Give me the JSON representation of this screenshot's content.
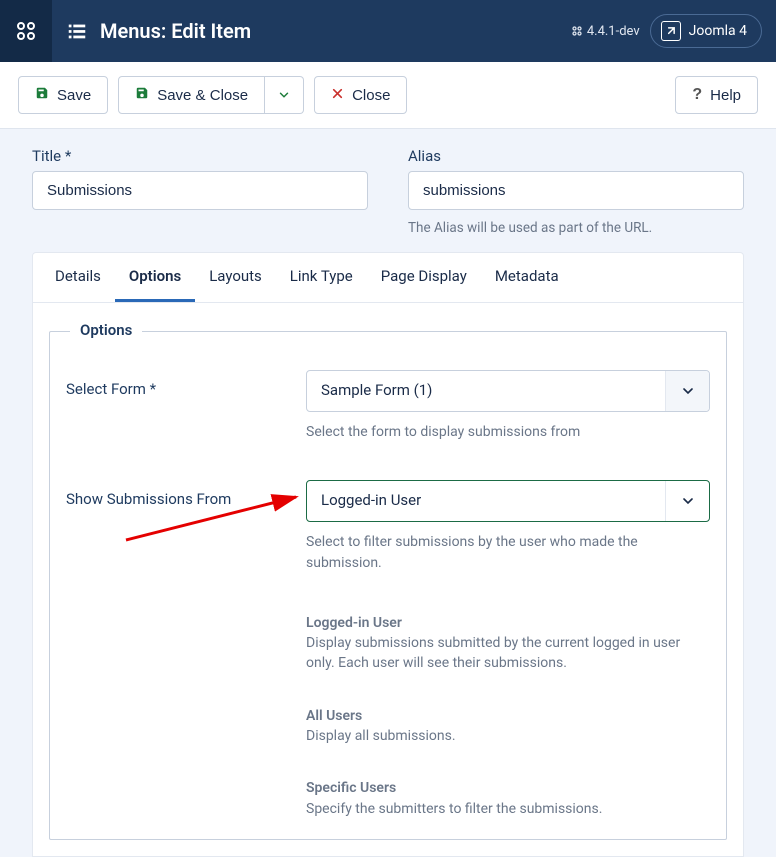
{
  "header": {
    "title": "Menus: Edit Item",
    "version": "4.4.1-dev",
    "badge": "Joomla 4"
  },
  "toolbar": {
    "save": "Save",
    "save_close": "Save & Close",
    "close": "Close",
    "help": "Help"
  },
  "fields": {
    "title_label": "Title *",
    "title_value": "Submissions",
    "alias_label": "Alias",
    "alias_value": "submissions",
    "alias_hint": "The Alias will be used as part of the URL."
  },
  "tabs": [
    "Details",
    "Options",
    "Layouts",
    "Link Type",
    "Page Display",
    "Metadata"
  ],
  "active_tab": "Options",
  "fieldset_legend": "Options",
  "controls": {
    "select_form": {
      "label": "Select Form *",
      "value": "Sample Form (1)",
      "hint": "Select the form to display submissions from"
    },
    "show_from": {
      "label": "Show Submissions From",
      "value": "Logged-in User",
      "hint": "Select to filter submissions by the user who made the submission.",
      "options": [
        {
          "title": "Logged-in User",
          "desc": "Display submissions submitted by the current logged in user only. Each user will see their submissions."
        },
        {
          "title": "All Users",
          "desc": "Display all submissions."
        },
        {
          "title": "Specific Users",
          "desc": "Specify the submitters to filter the submissions."
        }
      ]
    }
  }
}
